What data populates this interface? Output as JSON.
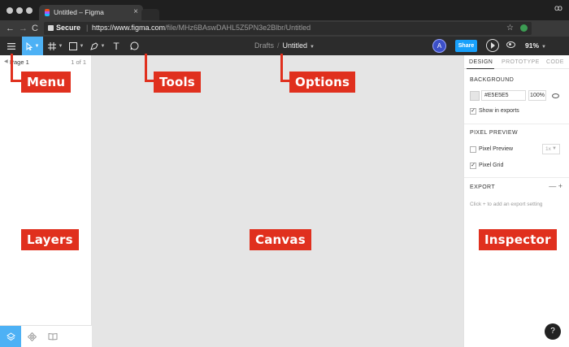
{
  "browser": {
    "tab_title": "Untitled – Figma",
    "tab_close": "×",
    "back": "←",
    "forward": "→",
    "reload": "C",
    "secure_label": "Secure",
    "url_host": "https://www.figma.com",
    "url_path": "/file/MHz6BAswDAHL5Z5PN3e2Blbr/Untitled",
    "star": "☆",
    "profile_glyph": "ꝏ"
  },
  "toolbar": {
    "breadcrumb_root": "Drafts",
    "breadcrumb_sep": "/",
    "file_name": "Untitled",
    "avatar_letter": "A",
    "share_label": "Share",
    "zoom": "91%",
    "text_tool": "T"
  },
  "layers": {
    "page_name": "Page 1",
    "page_count": "1 of 1"
  },
  "inspector": {
    "tabs": [
      "DESIGN",
      "PROTOTYPE",
      "CODE"
    ],
    "background_title": "BACKGROUND",
    "background_hex": "#E5E5E5",
    "background_opacity": "100%",
    "show_in_exports": "Show in exports",
    "pixel_preview_title": "PIXEL PREVIEW",
    "pixel_preview_label": "Pixel Preview",
    "pixel_preview_scale": "1x",
    "pixel_grid_label": "Pixel Grid",
    "export_title": "EXPORT",
    "export_icons": "—  +",
    "export_hint": "Click + to add an export setting",
    "checkmark": "✓"
  },
  "help_label": "?",
  "annotations": {
    "menu": "Menu",
    "tools": "Tools",
    "options": "Options",
    "layers": "Layers",
    "canvas": "Canvas",
    "inspector": "Inspector"
  },
  "colors": {
    "accent": "#18a0fb",
    "active_tool": "#4db1f5",
    "toolbar": "#2c2c2c",
    "canvas": "#e5e5e5",
    "callout": "#e0301e"
  }
}
